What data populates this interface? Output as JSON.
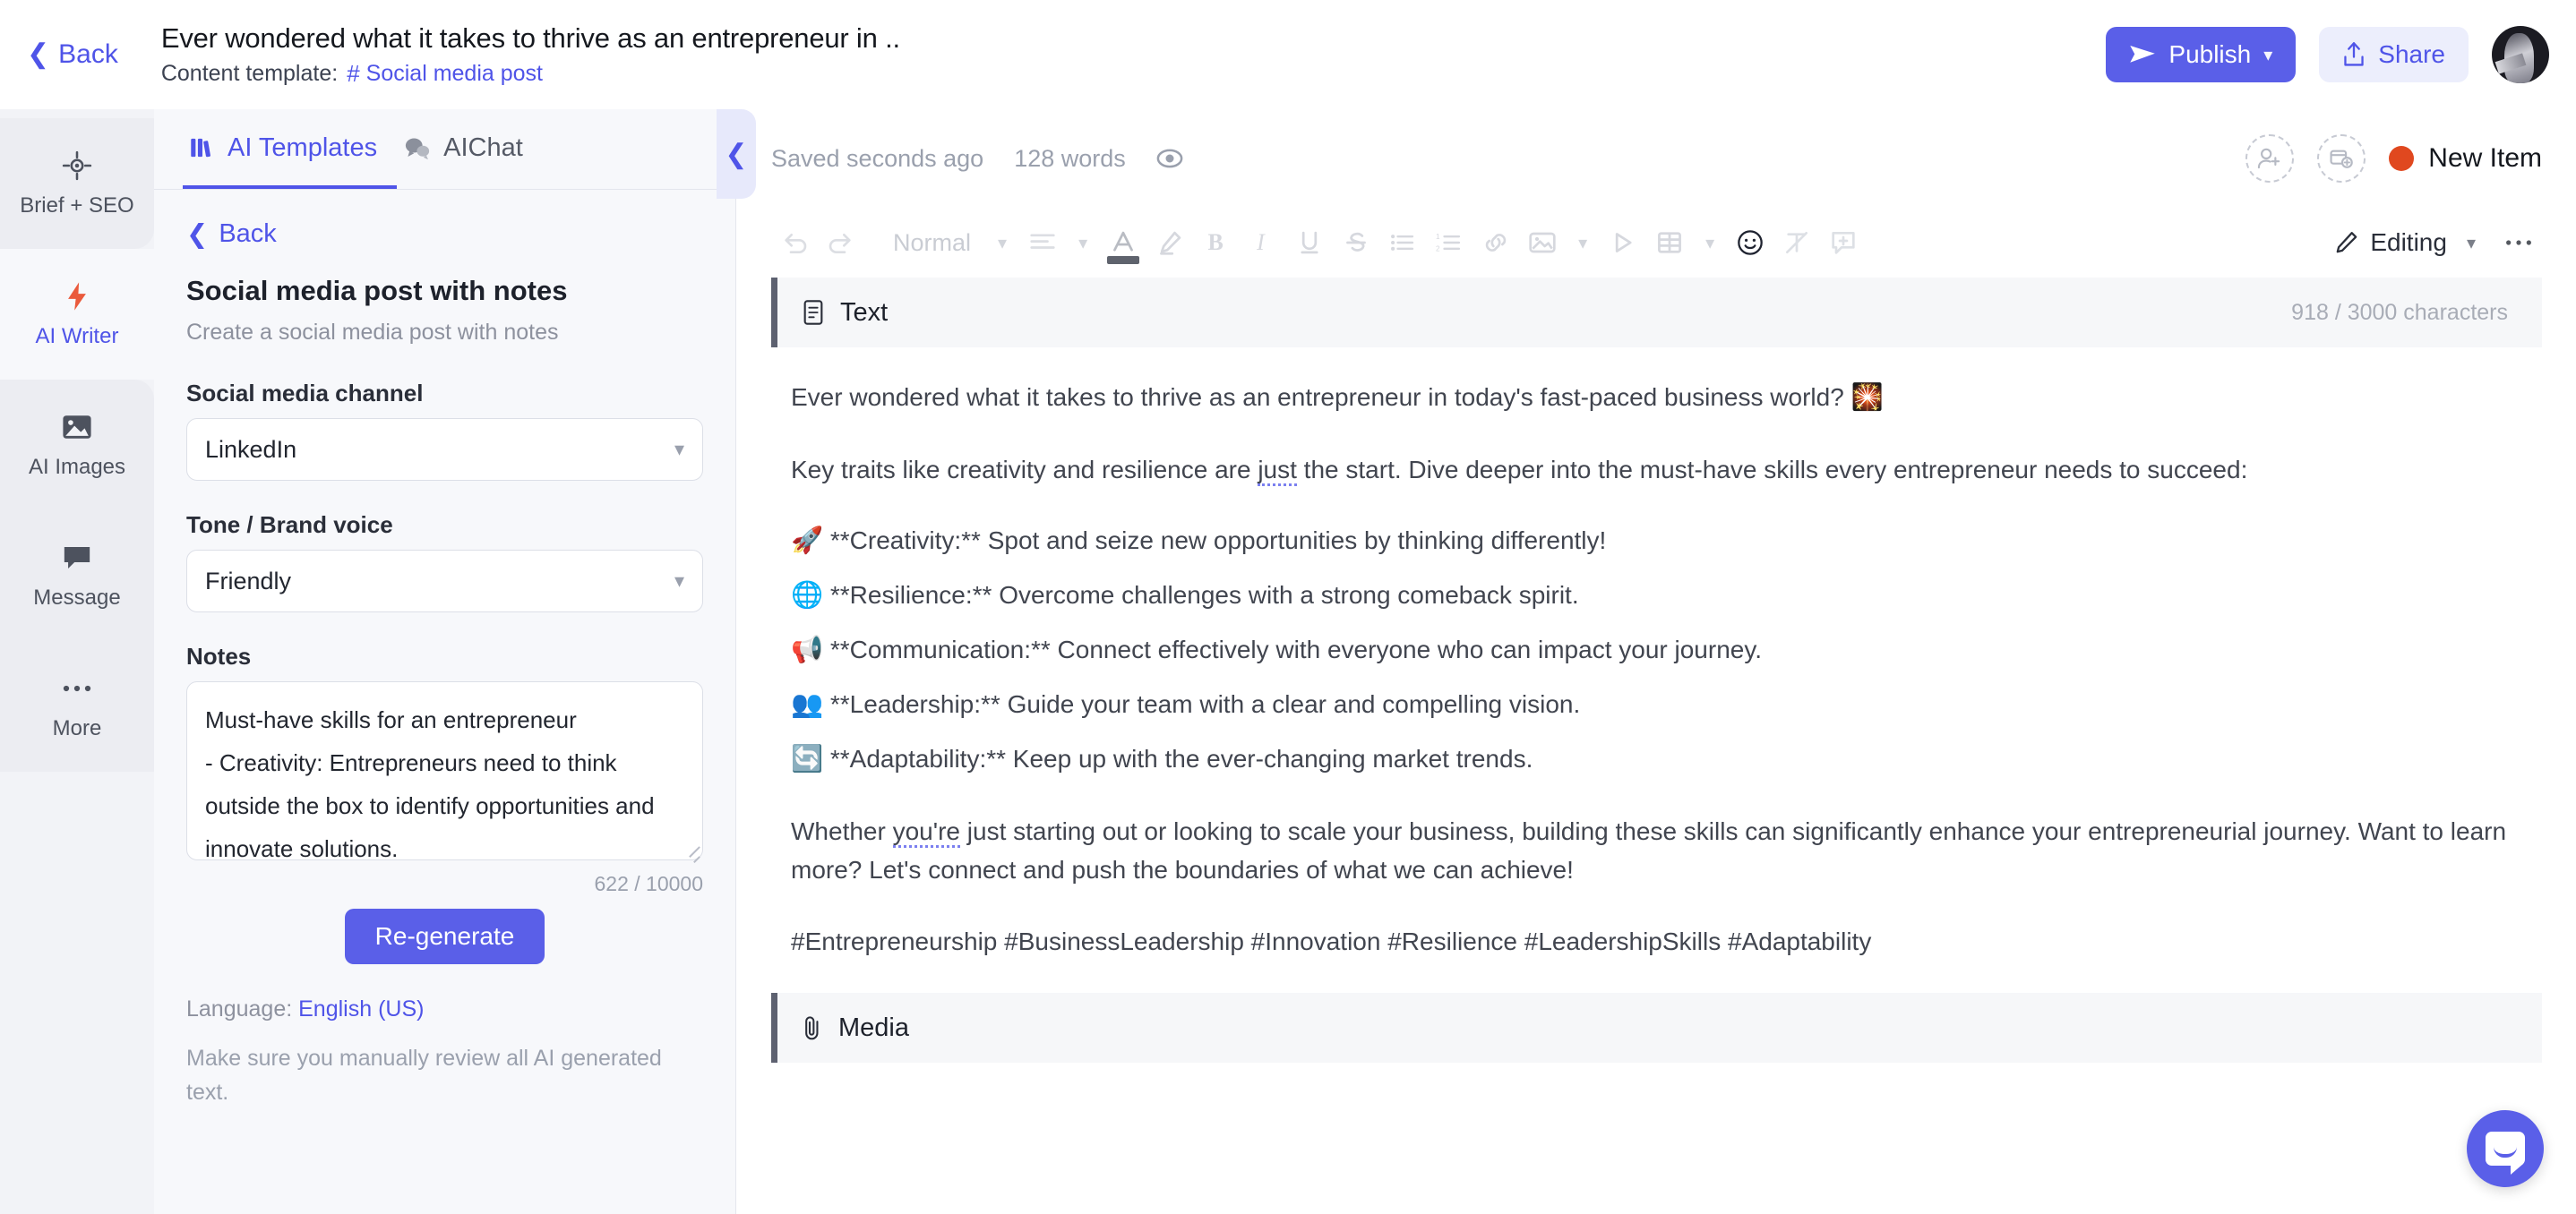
{
  "topbar": {
    "back_label": "Back",
    "doc_title": "Ever wondered what it takes to thrive as an entrepreneur in ..",
    "template_label": "Content template:",
    "template_name": "Social media post",
    "template_hash": "#",
    "publish_label": "Publish",
    "share_label": "Share"
  },
  "rail": {
    "items": [
      {
        "label": "Brief + SEO",
        "icon": "target-icon"
      },
      {
        "label": "AI Writer",
        "icon": "lightning-icon"
      },
      {
        "label": "AI Images",
        "icon": "image-icon"
      },
      {
        "label": "Message",
        "icon": "chat-icon"
      },
      {
        "label": "More",
        "icon": "ellipsis-icon"
      }
    ],
    "active": "AI Writer"
  },
  "panel": {
    "tabs": [
      {
        "label": "AI Templates",
        "icon": "templates-icon",
        "active": true
      },
      {
        "label": "AIChat",
        "icon": "chat-bubbles-icon",
        "active": false
      }
    ],
    "back_label": "Back",
    "template_title": "Social media post with notes",
    "template_subtitle": "Create a social media post with notes",
    "channel_label": "Social media channel",
    "channel_value": "LinkedIn",
    "tone_label": "Tone / Brand voice",
    "tone_value": "Friendly",
    "notes_label": "Notes",
    "notes_value": "Must-have skills for an entrepreneur\n- Creativity: Entrepreneurs need to think outside the box to identify opportunities and innovate solutions.",
    "notes_counter": "622 / 10000",
    "regenerate_label": "Re-generate",
    "language_prefix": "Language: ",
    "language_value": "English (US)",
    "disclaimer": "Make sure you manually review all AI generated text."
  },
  "editor": {
    "saved_text": "Saved seconds ago",
    "word_count": "128 words",
    "status_label": "New Item",
    "status_color": "#e0481f",
    "toolbar": {
      "block_style": "Normal",
      "mode_label": "Editing"
    },
    "sections": [
      {
        "title": "Text",
        "icon": "document-icon",
        "counter": "918 / 3000 characters"
      },
      {
        "title": "Media",
        "icon": "paperclip-icon",
        "counter": ""
      }
    ],
    "content": {
      "p1_pre": "Ever wondered what it takes to thrive as an entrepreneur in today's fast-paced business world? ",
      "p1_emoji": "🎇",
      "p2_a": "Key traits like creativity and resilience are ",
      "p2_spell": "just",
      "p2_b": " the start. Dive deeper into the must-have skills every entrepreneur needs to succeed:",
      "bullets": [
        {
          "emoji": "🚀",
          "text": "**Creativity:** Spot and seize new opportunities by thinking differently!"
        },
        {
          "emoji": "🌐",
          "text": "**Resilience:** Overcome challenges with a strong comeback spirit."
        },
        {
          "emoji": "📢",
          "text": "**Communication:** Connect effectively with everyone who can impact your journey."
        },
        {
          "emoji": "👥",
          "text": "**Leadership:** Guide your team with a clear and compelling vision."
        },
        {
          "emoji": "🔄",
          "text": "**Adaptability:** Keep up with the ever-changing market trends."
        }
      ],
      "p3_a": "Whether ",
      "p3_spell": "you're",
      "p3_b": " just starting out or looking to scale your business, building these skills can significantly enhance your entrepreneurial journey. Want to learn more? Let's connect and push the boundaries of what we can achieve!",
      "p4": "#Entrepreneurship #BusinessLeadership #Innovation #Resilience #LeadershipSkills #Adaptability"
    }
  },
  "colors": {
    "accent": "#5a5fe8",
    "accent_soft": "#eceefc",
    "status": "#e0481f",
    "panel_bg": "#f7f8fb",
    "rail_bg": "#f2f3f7"
  }
}
